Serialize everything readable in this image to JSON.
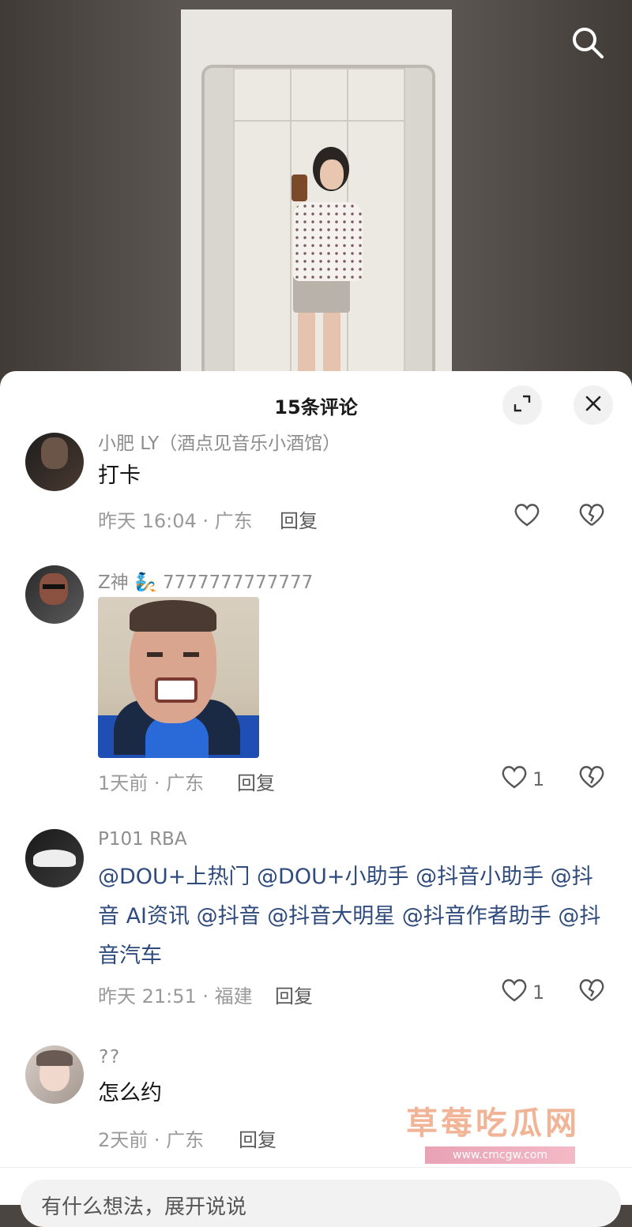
{
  "header": {
    "comment_count_title": "15条评论"
  },
  "icons": {
    "search": "search-icon",
    "expand": "expand-icon",
    "close": "close-icon",
    "like": "heart-icon",
    "dislike": "broken-heart-icon"
  },
  "comments": [
    {
      "username": "小肥 LY（酒点见音乐小酒馆）",
      "text": "打卡",
      "time_location": "昨天 16:04 · 广东",
      "reply_label": "回复",
      "likes": ""
    },
    {
      "username": "Z神 🧞 7777777777777",
      "sticker": "meme-face-sticker",
      "time_location": "1天前 · 广东",
      "reply_label": "回复",
      "likes": "1"
    },
    {
      "username": "P101 RBA",
      "mentions": [
        "@DOU+上热门",
        "@DOU+小助手",
        "@抖音小助手",
        "@抖音 AI资讯",
        "@抖音",
        "@抖音大明星",
        "@抖音作者助手",
        "@抖音汽车"
      ],
      "time_location": "昨天 21:51 · 福建",
      "reply_label": "回复",
      "likes": "1"
    },
    {
      "username": "??",
      "text": "怎么约",
      "time_location": "2天前 · 广东",
      "reply_label": "回复",
      "likes": ""
    }
  ],
  "input": {
    "placeholder": "有什么想法，展开说说"
  },
  "watermark": {
    "title": "草莓吃瓜网",
    "url": "www.cmcgw.com"
  },
  "colors": {
    "mention": "#2f4a7c",
    "meta": "#9a9a9a",
    "watermark": "#f0a784"
  }
}
